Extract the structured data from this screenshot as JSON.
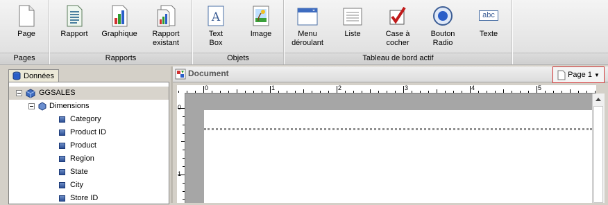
{
  "ribbon": {
    "buttons": [
      {
        "label": "Page",
        "icon": "page-icon"
      },
      {
        "label": "Rapport",
        "icon": "report-icon"
      },
      {
        "label": "Graphique",
        "icon": "chart-icon"
      },
      {
        "label": "Rapport\nexistant",
        "icon": "existing-report-icon"
      },
      {
        "label": "Text\nBox",
        "icon": "textbox-icon"
      },
      {
        "label": "Image",
        "icon": "image-icon"
      },
      {
        "label": "Menu\ndéroulant",
        "icon": "dropdown-menu-icon"
      },
      {
        "label": "Liste",
        "icon": "list-icon"
      },
      {
        "label": "Case à\ncocher",
        "icon": "checkbox-icon"
      },
      {
        "label": "Bouton\nRadio",
        "icon": "radio-button-icon"
      },
      {
        "label": "Texte",
        "icon": "text-icon",
        "icon_text": "abc"
      }
    ],
    "groups": [
      "Pages",
      "Rapports",
      "Objets",
      "Tableau de bord actif"
    ]
  },
  "left_panel": {
    "tab_label": "Données",
    "tree": {
      "root": "GGSALES",
      "folder": "Dimensions",
      "fields": [
        "Category",
        "Product ID",
        "Product",
        "Region",
        "State",
        "City",
        "Store ID"
      ]
    }
  },
  "document": {
    "title": "Document",
    "page_selector": "Page 1",
    "ruler_h": [
      "0",
      "1",
      "2",
      "3",
      "4",
      "5"
    ],
    "ruler_v": [
      "0",
      "1"
    ]
  }
}
